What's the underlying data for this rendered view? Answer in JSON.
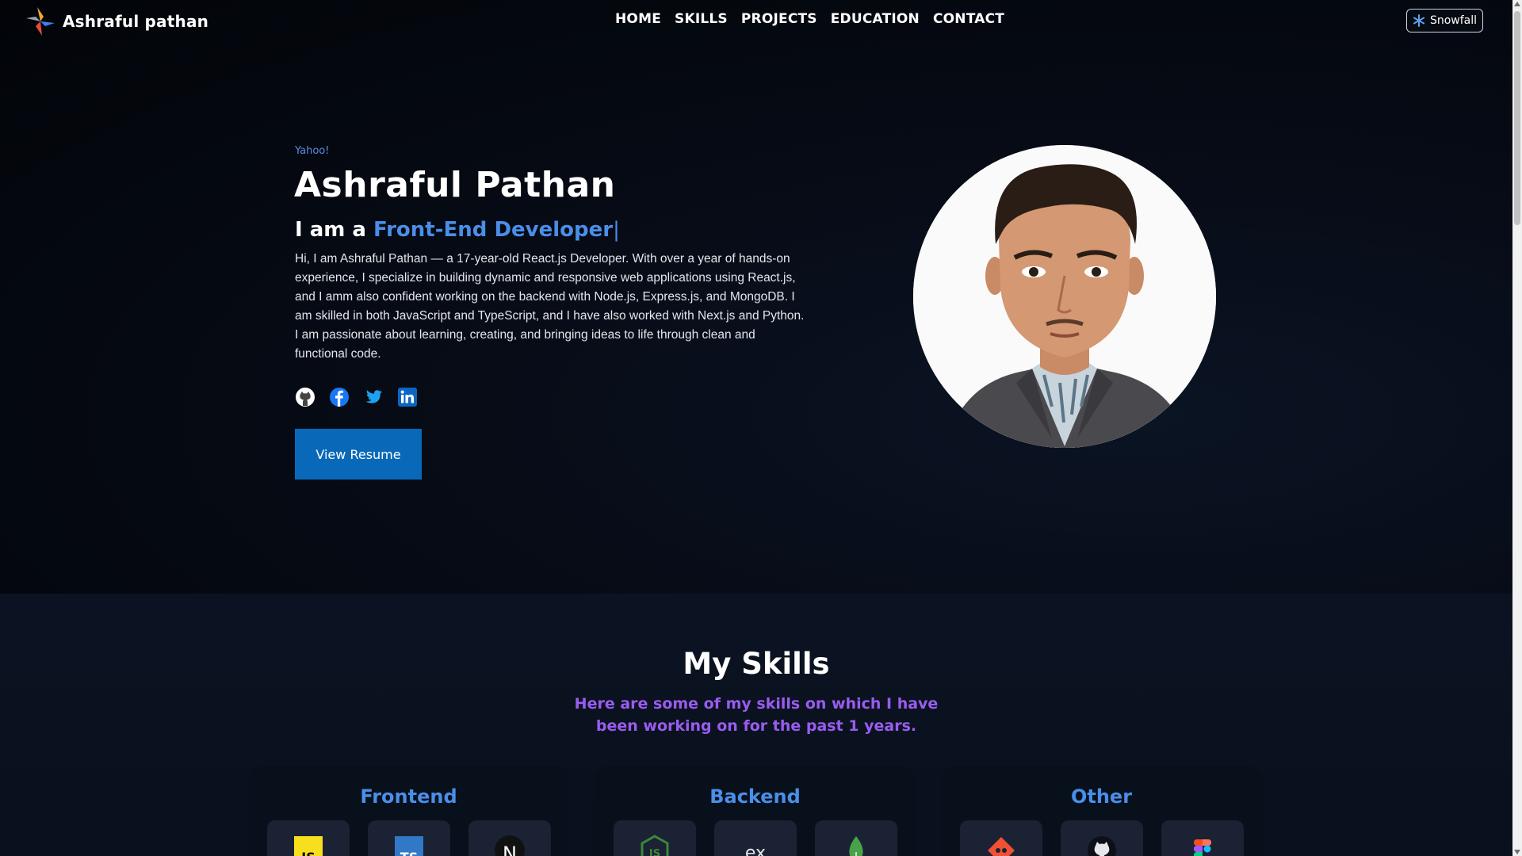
{
  "navbar": {
    "brand_name": "Ashraful pathan",
    "links": [
      "HOME",
      "SKILLS",
      "PROJECTS",
      "EDUCATION",
      "CONTACT"
    ],
    "snowfall_label": "Snowfall"
  },
  "hero": {
    "kicker": "Yahoo!",
    "name": "Ashraful Pathan",
    "role_prefix": "I am a ",
    "role_text": "Front-End Developer",
    "cursor": "|",
    "bio": "Hi, I am Ashraful Pathan — a 17-year-old React.js Developer. With over a year of hands-on experience, I specialize in building dynamic and responsive web applications using React.js, and I amm also confident working on the backend with Node.js, Express.js, and MongoDB. I am skilled in both JavaScript and TypeScript, and I have also worked with Next.js and Python. I am passionate about learning, creating, and bringing ideas to life through clean and functional code.",
    "socials": [
      "github-icon",
      "facebook-icon",
      "twitter-icon",
      "linkedin-icon"
    ],
    "resume_label": "View Resume"
  },
  "skills": {
    "title": "My Skills",
    "subtitle": "Here are some of my skills on which I have been working on for the past 1 years.",
    "categories": [
      {
        "title": "Frontend",
        "icons": [
          "javascript-icon",
          "typescript-icon",
          "nextjs-icon"
        ]
      },
      {
        "title": "Backend",
        "icons": [
          "nodejs-icon",
          "express-icon",
          "mongodb-icon"
        ]
      },
      {
        "title": "Other",
        "icons": [
          "git-icon",
          "github-icon",
          "figma-icon"
        ]
      }
    ]
  },
  "colors": {
    "accent_blue": "#4a8ee8",
    "subtitle_purple": "#9a5cf0",
    "resume_button": "#0969b8",
    "background": "#03060d"
  }
}
